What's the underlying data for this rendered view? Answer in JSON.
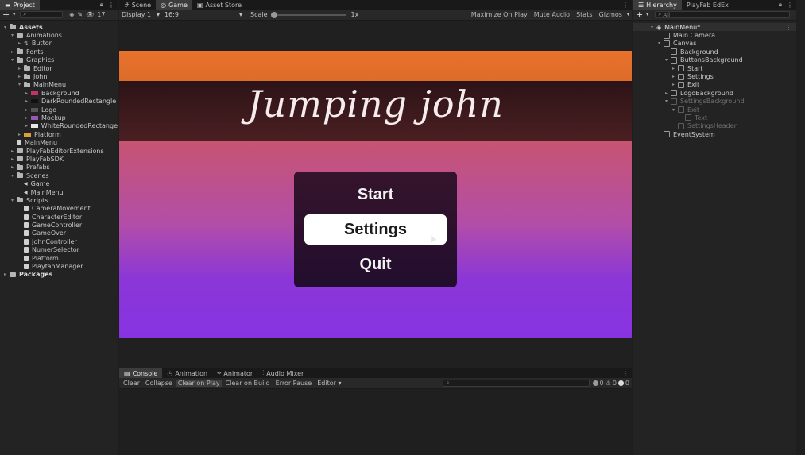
{
  "project": {
    "tab": "Project",
    "add_label": "+",
    "hide_count": "17",
    "tree": [
      {
        "label": "Assets",
        "level": 0,
        "arrow": "▾",
        "icon": "folder",
        "bold": true
      },
      {
        "label": "Animations",
        "level": 1,
        "arrow": "▾",
        "icon": "folder"
      },
      {
        "label": "Button",
        "level": 2,
        "arrow": "▸",
        "icon": "animator"
      },
      {
        "label": "Fonts",
        "level": 1,
        "arrow": "▸",
        "icon": "folder"
      },
      {
        "label": "Graphics",
        "level": 1,
        "arrow": "▾",
        "icon": "folder"
      },
      {
        "label": "Editor",
        "level": 2,
        "arrow": "▸",
        "icon": "folder"
      },
      {
        "label": "John",
        "level": 2,
        "arrow": "▸",
        "icon": "folder"
      },
      {
        "label": "MainMenu",
        "level": 2,
        "arrow": "▾",
        "icon": "folder"
      },
      {
        "label": "Background",
        "level": 3,
        "arrow": "▸",
        "icon": "sprite",
        "color": "#c0336b"
      },
      {
        "label": "DarkRoundedRectangle",
        "level": 3,
        "arrow": "▸",
        "icon": "sprite",
        "color": "#111111"
      },
      {
        "label": "Logo",
        "level": 3,
        "arrow": "▸",
        "icon": "sprite",
        "color": "#555555"
      },
      {
        "label": "Mockup",
        "level": 3,
        "arrow": "▸",
        "icon": "sprite",
        "color": "#9a55b5"
      },
      {
        "label": "WhiteRoundedRectange",
        "level": 3,
        "arrow": "▸",
        "icon": "sprite",
        "color": "#e8e8e8"
      },
      {
        "label": "Platform",
        "level": 2,
        "arrow": "▸",
        "icon": "sprite",
        "color": "#d7a23a"
      },
      {
        "label": "MainMenu",
        "level": 1,
        "arrow": "",
        "icon": "file"
      },
      {
        "label": "PlayFabEditorExtensions",
        "level": 1,
        "arrow": "▸",
        "icon": "folder"
      },
      {
        "label": "PlayFabSDK",
        "level": 1,
        "arrow": "▸",
        "icon": "folder"
      },
      {
        "label": "Prefabs",
        "level": 1,
        "arrow": "▸",
        "icon": "folder"
      },
      {
        "label": "Scenes",
        "level": 1,
        "arrow": "▾",
        "icon": "folder"
      },
      {
        "label": "Game",
        "level": 2,
        "arrow": "",
        "icon": "scene"
      },
      {
        "label": "MainMenu",
        "level": 2,
        "arrow": "",
        "icon": "scene"
      },
      {
        "label": "Scripts",
        "level": 1,
        "arrow": "▾",
        "icon": "folder"
      },
      {
        "label": "CameraMovement",
        "level": 2,
        "arrow": "",
        "icon": "script"
      },
      {
        "label": "CharacterEditor",
        "level": 2,
        "arrow": "",
        "icon": "script"
      },
      {
        "label": "GameController",
        "level": 2,
        "arrow": "",
        "icon": "script"
      },
      {
        "label": "GameOver",
        "level": 2,
        "arrow": "",
        "icon": "script"
      },
      {
        "label": "JohnController",
        "level": 2,
        "arrow": "",
        "icon": "script"
      },
      {
        "label": "NumerSelector",
        "level": 2,
        "arrow": "",
        "icon": "script"
      },
      {
        "label": "Platform",
        "level": 2,
        "arrow": "",
        "icon": "script"
      },
      {
        "label": "PlayfabManager",
        "level": 2,
        "arrow": "",
        "icon": "script"
      },
      {
        "label": "Packages",
        "level": 0,
        "arrow": "▸",
        "icon": "folder",
        "bold": true
      }
    ]
  },
  "center_tabs": [
    {
      "label": "Scene",
      "icon": "#",
      "active": false
    },
    {
      "label": "Game",
      "icon": "◎",
      "active": true
    },
    {
      "label": "Asset Store",
      "icon": "▣",
      "active": false
    }
  ],
  "game_toolbar": {
    "display": "Display 1",
    "aspect": "16:9",
    "scale_label": "Scale",
    "scale_value": "1x",
    "maximize": "Maximize On Play",
    "mute": "Mute Audio",
    "stats": "Stats",
    "gizmos": "Gizmos"
  },
  "game": {
    "title": "Jumping john",
    "buttons": [
      {
        "label": "Start",
        "selected": false
      },
      {
        "label": "Settings",
        "selected": true
      },
      {
        "label": "Quit",
        "selected": false
      }
    ]
  },
  "console": {
    "tabs": [
      {
        "label": "Console",
        "icon": "▤",
        "active": true
      },
      {
        "label": "Animation",
        "icon": "◷",
        "active": false
      },
      {
        "label": "Animator",
        "icon": "⟡",
        "active": false
      },
      {
        "label": "Audio Mixer",
        "icon": "⫶",
        "active": false
      }
    ],
    "buttons": [
      {
        "label": "Clear",
        "on": false
      },
      {
        "label": "Collapse",
        "on": false
      },
      {
        "label": "Clear on Play",
        "on": true
      },
      {
        "label": "Clear on Build",
        "on": false
      },
      {
        "label": "Error Pause",
        "on": false
      },
      {
        "label": "Editor ▾",
        "on": false
      }
    ],
    "counts": {
      "info": "0",
      "warn": "0",
      "error": "0"
    }
  },
  "hierarchy": {
    "tabs": [
      {
        "label": "Hierarchy",
        "active": true
      },
      {
        "label": "PlayFab EdEx",
        "active": false
      }
    ],
    "search_placeholder": "All",
    "items": [
      {
        "label": "MainMenu*",
        "level": 0,
        "arrow": "▾",
        "icon": "scene",
        "dim": false,
        "bold": true
      },
      {
        "label": "Main Camera",
        "level": 1,
        "arrow": "",
        "icon": "cube",
        "dim": false
      },
      {
        "label": "Canvas",
        "level": 1,
        "arrow": "▾",
        "icon": "cube",
        "dim": false
      },
      {
        "label": "Background",
        "level": 2,
        "arrow": "",
        "icon": "cube",
        "dim": false
      },
      {
        "label": "ButtonsBackground",
        "level": 2,
        "arrow": "▾",
        "icon": "cube",
        "dim": false
      },
      {
        "label": "Start",
        "level": 3,
        "arrow": "▸",
        "icon": "cube",
        "dim": false
      },
      {
        "label": "Settings",
        "level": 3,
        "arrow": "▸",
        "icon": "cube",
        "dim": false
      },
      {
        "label": "Exit",
        "level": 3,
        "arrow": "▸",
        "icon": "cube",
        "dim": false
      },
      {
        "label": "LogoBackground",
        "level": 2,
        "arrow": "▸",
        "icon": "cube",
        "dim": false
      },
      {
        "label": "SettingsBackground",
        "level": 2,
        "arrow": "▾",
        "icon": "cube",
        "dim": true
      },
      {
        "label": "Exit",
        "level": 3,
        "arrow": "▾",
        "icon": "cube",
        "dim": true
      },
      {
        "label": "Text",
        "level": 4,
        "arrow": "",
        "icon": "cube",
        "dim": true
      },
      {
        "label": "SettingsHeader",
        "level": 3,
        "arrow": "",
        "icon": "cube",
        "dim": true
      },
      {
        "label": "EventSystem",
        "level": 1,
        "arrow": "",
        "icon": "cube",
        "dim": false
      }
    ]
  }
}
